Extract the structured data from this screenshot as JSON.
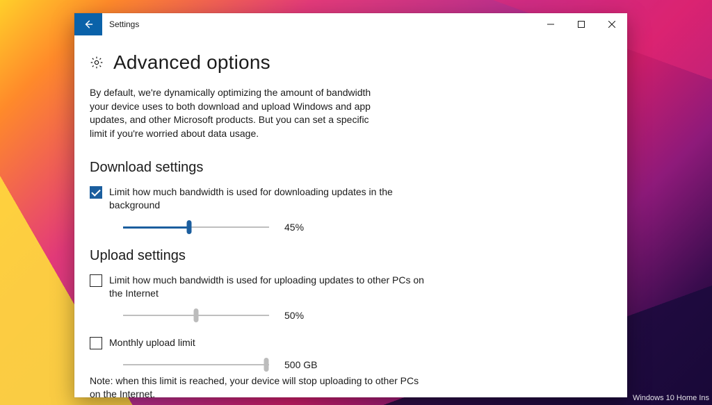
{
  "titlebar": {
    "back_aria": "Back",
    "title": "Settings"
  },
  "page": {
    "title": "Advanced options",
    "intro": "By default, we're dynamically optimizing the amount of bandwidth your device uses to both download and upload Windows and app updates, and other Microsoft products. But you can set a specific limit if you're worried about data usage."
  },
  "download": {
    "heading": "Download settings",
    "limit_label": "Limit how much bandwidth is used for downloading updates in the background",
    "limit_checked": true,
    "slider_percent": 45,
    "slider_display": "45%"
  },
  "upload": {
    "heading": "Upload settings",
    "limit_label": "Limit how much bandwidth is used for uploading updates to other PCs on the Internet",
    "limit_checked": false,
    "slider_percent": 50,
    "slider_display": "50%",
    "monthly_label": "Monthly upload limit",
    "monthly_checked": false,
    "monthly_slider_percent": 98,
    "monthly_slider_display": "500 GB",
    "note": "Note: when this limit is reached, your device will stop uploading to other PCs on the Internet."
  },
  "watermark": "Windows 10 Home Ins"
}
